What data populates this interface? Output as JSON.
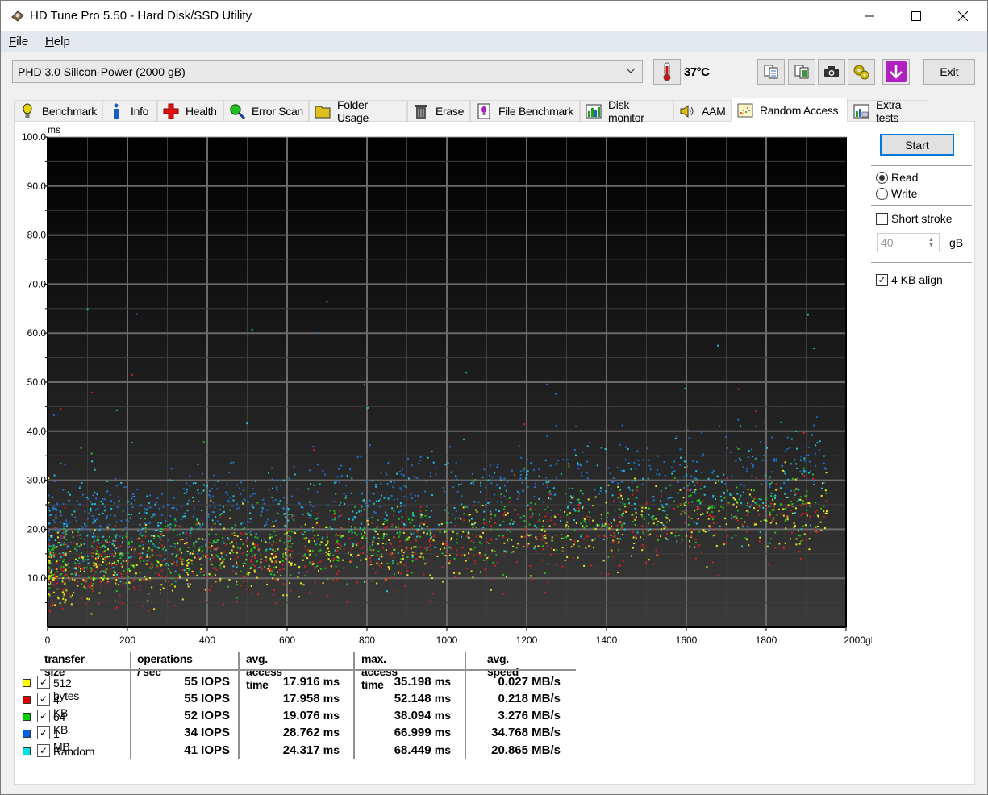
{
  "window": {
    "title": "HD Tune Pro 5.50 - Hard Disk/SSD Utility",
    "controls": {
      "minimize": "minimize-icon",
      "maximize": "maximize-icon",
      "close": "close-icon"
    }
  },
  "menu": [
    {
      "label": "File",
      "accel": "F",
      "rest": "ile"
    },
    {
      "label": "Help",
      "accel": "H",
      "rest": "elp"
    }
  ],
  "toolbar": {
    "drive": "PHD 3.0 Silicon-Power (2000 gB)",
    "temperature": "37°C",
    "buttons": [
      {
        "icon": "copy-text-icon"
      },
      {
        "icon": "copy-image-icon"
      },
      {
        "icon": "screenshot-camera-icon"
      },
      {
        "icon": "options-gears-icon"
      },
      {
        "icon": "save-download-icon"
      }
    ],
    "exit_label": "Exit"
  },
  "tabs": [
    {
      "label": "Benchmark",
      "icon": "lightbulb-icon"
    },
    {
      "label": "Info",
      "icon": "info-icon"
    },
    {
      "label": "Health",
      "icon": "health-cross-icon"
    },
    {
      "label": "Error Scan",
      "icon": "magnifier-icon"
    },
    {
      "label": "Folder Usage",
      "icon": "folder-icon"
    },
    {
      "label": "Erase",
      "icon": "trash-icon"
    },
    {
      "label": "File Benchmark",
      "icon": "file-benchmark-icon"
    },
    {
      "label": "Disk monitor",
      "icon": "disk-monitor-icon"
    },
    {
      "label": "AAM",
      "icon": "speaker-icon"
    },
    {
      "label": "Random Access",
      "icon": "scatter-icon",
      "active": true
    },
    {
      "label": "Extra tests",
      "icon": "extra-tests-icon"
    }
  ],
  "side": {
    "start_label": "Start",
    "mode_options": [
      {
        "label": "Read",
        "selected": true
      },
      {
        "label": "Write",
        "selected": false
      }
    ],
    "short_stroke_label": "Short stroke",
    "short_stroke_checked": false,
    "short_stroke_value": "40",
    "short_stroke_unit": "gB",
    "align_label": "4 KB align",
    "align_checked": true
  },
  "results": {
    "headers": [
      "transfer size",
      "operations / sec",
      "avg. access time",
      "max. access time",
      "avg. speed"
    ],
    "rows": [
      {
        "label": "512 bytes",
        "color": "#ffff00",
        "checked": true,
        "ops": "55 IOPS",
        "avg_num": "17.916",
        "avg_unit": "ms",
        "max_num": "35.198",
        "max_unit": "ms",
        "speed": "0.027 MB/s"
      },
      {
        "label": "4 KB",
        "color": "#e00000",
        "checked": true,
        "ops": "55 IOPS",
        "avg_num": "17.958",
        "avg_unit": "ms",
        "max_num": "52.148",
        "max_unit": "ms",
        "speed": "0.218 MB/s"
      },
      {
        "label": "64 KB",
        "color": "#00d000",
        "checked": true,
        "ops": "52 IOPS",
        "avg_num": "19.076",
        "avg_unit": "ms",
        "max_num": "38.094",
        "max_unit": "ms",
        "speed": "3.276 MB/s"
      },
      {
        "label": "1 MB",
        "color": "#0060e0",
        "checked": true,
        "ops": "34 IOPS",
        "avg_num": "28.762",
        "avg_unit": "ms",
        "max_num": "66.999",
        "max_unit": "ms",
        "speed": "34.768 MB/s"
      },
      {
        "label": "Random",
        "color": "#00e0e0",
        "checked": true,
        "ops": "41 IOPS",
        "avg_num": "24.317",
        "avg_unit": "ms",
        "max_num": "68.449",
        "max_unit": "ms",
        "speed": "20.865 MB/s"
      }
    ]
  },
  "chart_data": {
    "type": "scatter",
    "title": "",
    "ylabel": "ms",
    "xlabel": "gB",
    "xlim": [
      0,
      2000
    ],
    "ylim": [
      0,
      100
    ],
    "x_ticks": [
      "0",
      "200",
      "400",
      "600",
      "800",
      "1000",
      "1200",
      "1400",
      "1600",
      "1800",
      "2000gB"
    ],
    "y_ticks": [
      "10.0",
      "20.0",
      "30.0",
      "40.0",
      "50.0",
      "60.0",
      "70.0",
      "80.0",
      "90.0",
      "100.0"
    ],
    "grid": true,
    "description": "Random access time vs. disk position; point clouds per transfer size, rising roughly linearly with position",
    "series": [
      {
        "name": "512 bytes",
        "color": "#e8e820",
        "center_at_0": 11,
        "center_at_2000": 24,
        "spread": 5,
        "max": 35.198
      },
      {
        "name": "4 KB",
        "color": "#d02020",
        "center_at_0": 11,
        "center_at_2000": 24,
        "spread": 6,
        "max": 52.148
      },
      {
        "name": "64 KB",
        "color": "#20c020",
        "center_at_0": 13,
        "center_at_2000": 26,
        "spread": 5,
        "max": 38.094
      },
      {
        "name": "1 MB",
        "color": "#2070d0",
        "center_at_0": 22,
        "center_at_2000": 36,
        "spread": 5,
        "max": 66.999
      },
      {
        "name": "Random",
        "color": "#20c8d8",
        "center_at_0": 18,
        "center_at_2000": 30,
        "spread": 7,
        "max": 68.449
      }
    ]
  }
}
